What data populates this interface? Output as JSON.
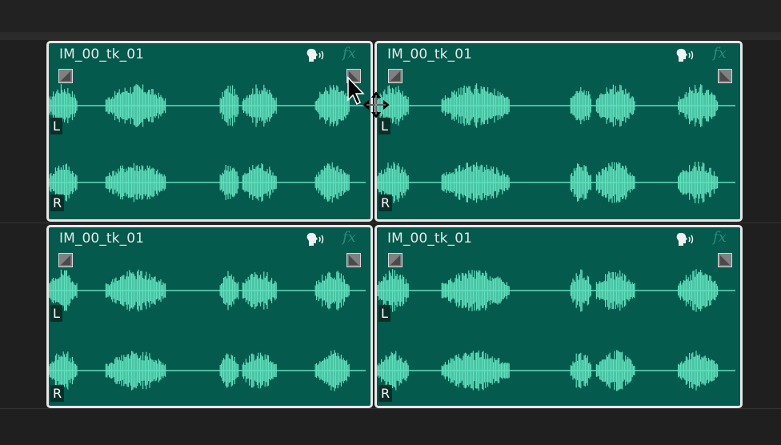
{
  "clips": [
    {
      "name": "IM_00_tk_01",
      "fx_label": "fx",
      "left_channel": "L",
      "right_channel": "R"
    },
    {
      "name": "IM_00_tk_01",
      "fx_label": "fx",
      "left_channel": "L",
      "right_channel": "R"
    },
    {
      "name": "IM_00_tk_01",
      "fx_label": "fx",
      "left_channel": "L",
      "right_channel": "R"
    },
    {
      "name": "IM_00_tk_01",
      "fx_label": "fx",
      "left_channel": "L",
      "right_channel": "R"
    }
  ],
  "icons": {
    "voice": "voice-speech-icon",
    "fade_in": "fade-in-handle-icon",
    "fade_out": "fade-out-handle-icon",
    "cursor": "move-cursor-icon"
  },
  "colors": {
    "clip_background": "#035a4d",
    "waveform": "#5fe0bd",
    "clip_border": "#e6e6e6",
    "timeline_background": "#1f1f1f"
  }
}
